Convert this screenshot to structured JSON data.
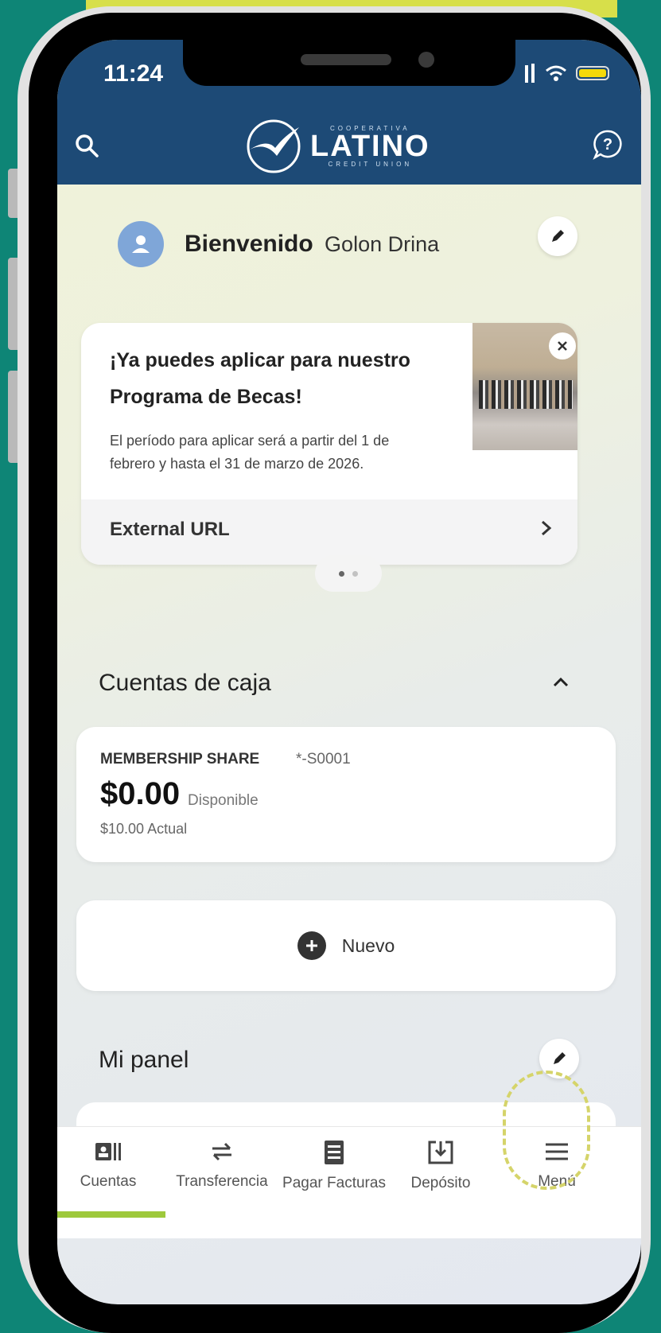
{
  "status_bar": {
    "time": "11:24"
  },
  "header": {
    "logo_top": "COOPERATIVA",
    "logo_main": "LATINO",
    "logo_sub": "CREDIT UNION"
  },
  "welcome": {
    "greeting": "Bienvenido",
    "name": "Golon Drina"
  },
  "promo": {
    "title": "¡Ya puedes aplicar para nuestro Programa de Becas!",
    "description": "El período para aplicar será a partir del 1 de febrero y hasta el 31 de marzo de 2026.",
    "link_label": "External URL",
    "page": 1,
    "total_pages": 2
  },
  "accounts_section": {
    "title": "Cuentas de caja",
    "account": {
      "name": "MEMBERSHIP SHARE",
      "number": "*-S0001",
      "available_balance": "$0.00",
      "available_label": "Disponible",
      "current_balance": "$10.00 Actual"
    },
    "new_label": "Nuevo"
  },
  "panel_section": {
    "title": "Mi panel"
  },
  "tabs": [
    {
      "label": "Cuentas",
      "icon": "accounts-icon",
      "active": true
    },
    {
      "label": "Transferencia",
      "icon": "transfer-icon",
      "active": false
    },
    {
      "label": "Pagar Facturas",
      "icon": "bills-icon",
      "active": false
    },
    {
      "label": "Depósito",
      "icon": "deposit-icon",
      "active": false
    },
    {
      "label": "Menú",
      "icon": "menu-icon",
      "active": false
    }
  ],
  "colors": {
    "header": "#1d4a76",
    "background": "#0e8576",
    "tab_indicator": "#9ec93c",
    "highlight": "#d5d46a"
  }
}
